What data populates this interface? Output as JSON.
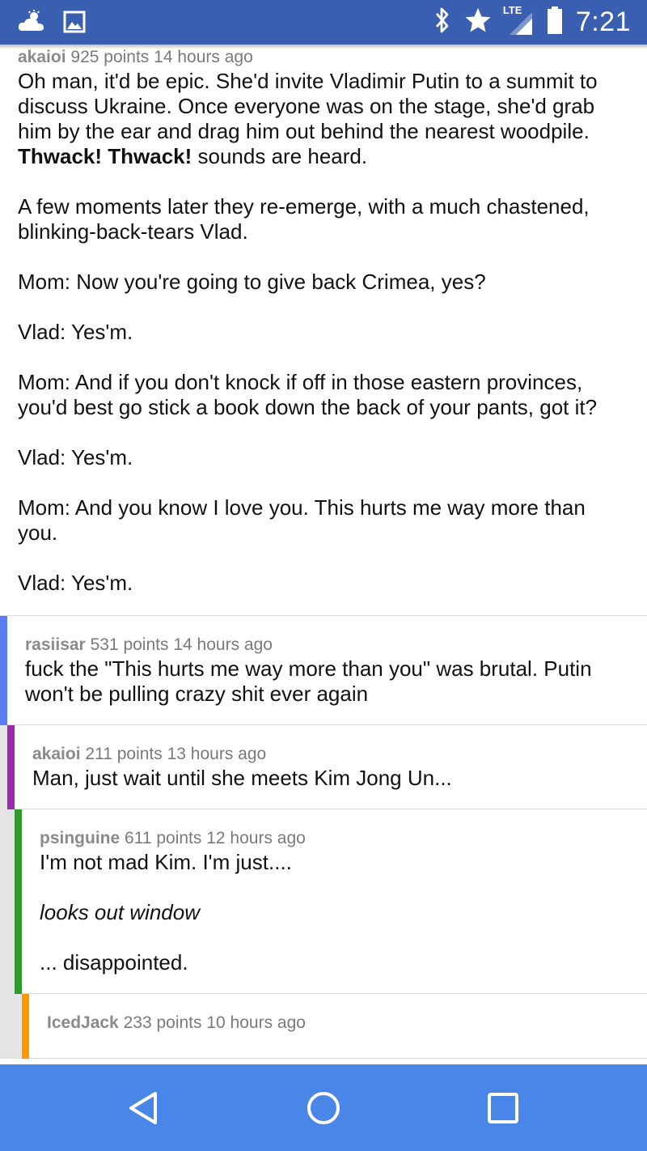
{
  "status_bar": {
    "time": "7:21",
    "network_label": "LTE",
    "icons": [
      "weather-icon",
      "image-icon",
      "bluetooth-icon",
      "star-icon",
      "signal-icon",
      "battery-icon"
    ],
    "color": "#3b5fb0"
  },
  "comments": [
    {
      "author": "akaioi",
      "points": "925 points",
      "time": "14 hours ago",
      "depth_color": null,
      "paragraphs": {
        "p1_bold": "Thwack! Thwack!",
        "p1_pre": "Oh man, it'd be epic. She'd invite Vladimir Putin to a summit to discuss Ukraine. Once everyone was on the stage, she'd grab him by the ear and drag him out behind the nearest woodpile. ",
        "p1_post": " sounds are heard.",
        "p2": "A few moments later they re-emerge, with a much chastened, blinking-back-tears Vlad.",
        "p3": "Mom: Now you're going to give back Crimea, yes?",
        "p4": "Vlad: Yes'm.",
        "p5": "Mom: And if you don't knock if off in those eastern provinces, you'd best go stick a book down the back of your pants, got it?",
        "p6": "Vlad: Yes'm.",
        "p7": "Mom: And you know I love you. This hurts me way more than you.",
        "p8": "Vlad: Yes'm."
      }
    },
    {
      "author": "rasiisar",
      "points": "531 points",
      "time": "14 hours ago",
      "depth_color": "#5b7cf0",
      "text": "fuck the \"This hurts me way more than you\" was brutal. Putin won't be pulling crazy shit ever again"
    },
    {
      "author": "akaioi",
      "points": "211 points",
      "time": "13 hours ago",
      "depth_color": "#9c27b0",
      "text": "Man, just wait until she meets Kim Jong Un..."
    },
    {
      "author": "psinguine",
      "points": "611 points",
      "time": "12 hours ago",
      "depth_color": "#2e9a2e",
      "p1": "I'm not mad Kim. I'm just....",
      "p2": "looks out window",
      "p3": "... disappointed."
    },
    {
      "author": "IcedJack",
      "points": "233 points",
      "time": "10 hours ago",
      "depth_color": "#ff9800"
    }
  ],
  "nav_bar": {
    "buttons": [
      "back-button",
      "home-button",
      "recents-button"
    ],
    "color": "#4a86e8"
  }
}
